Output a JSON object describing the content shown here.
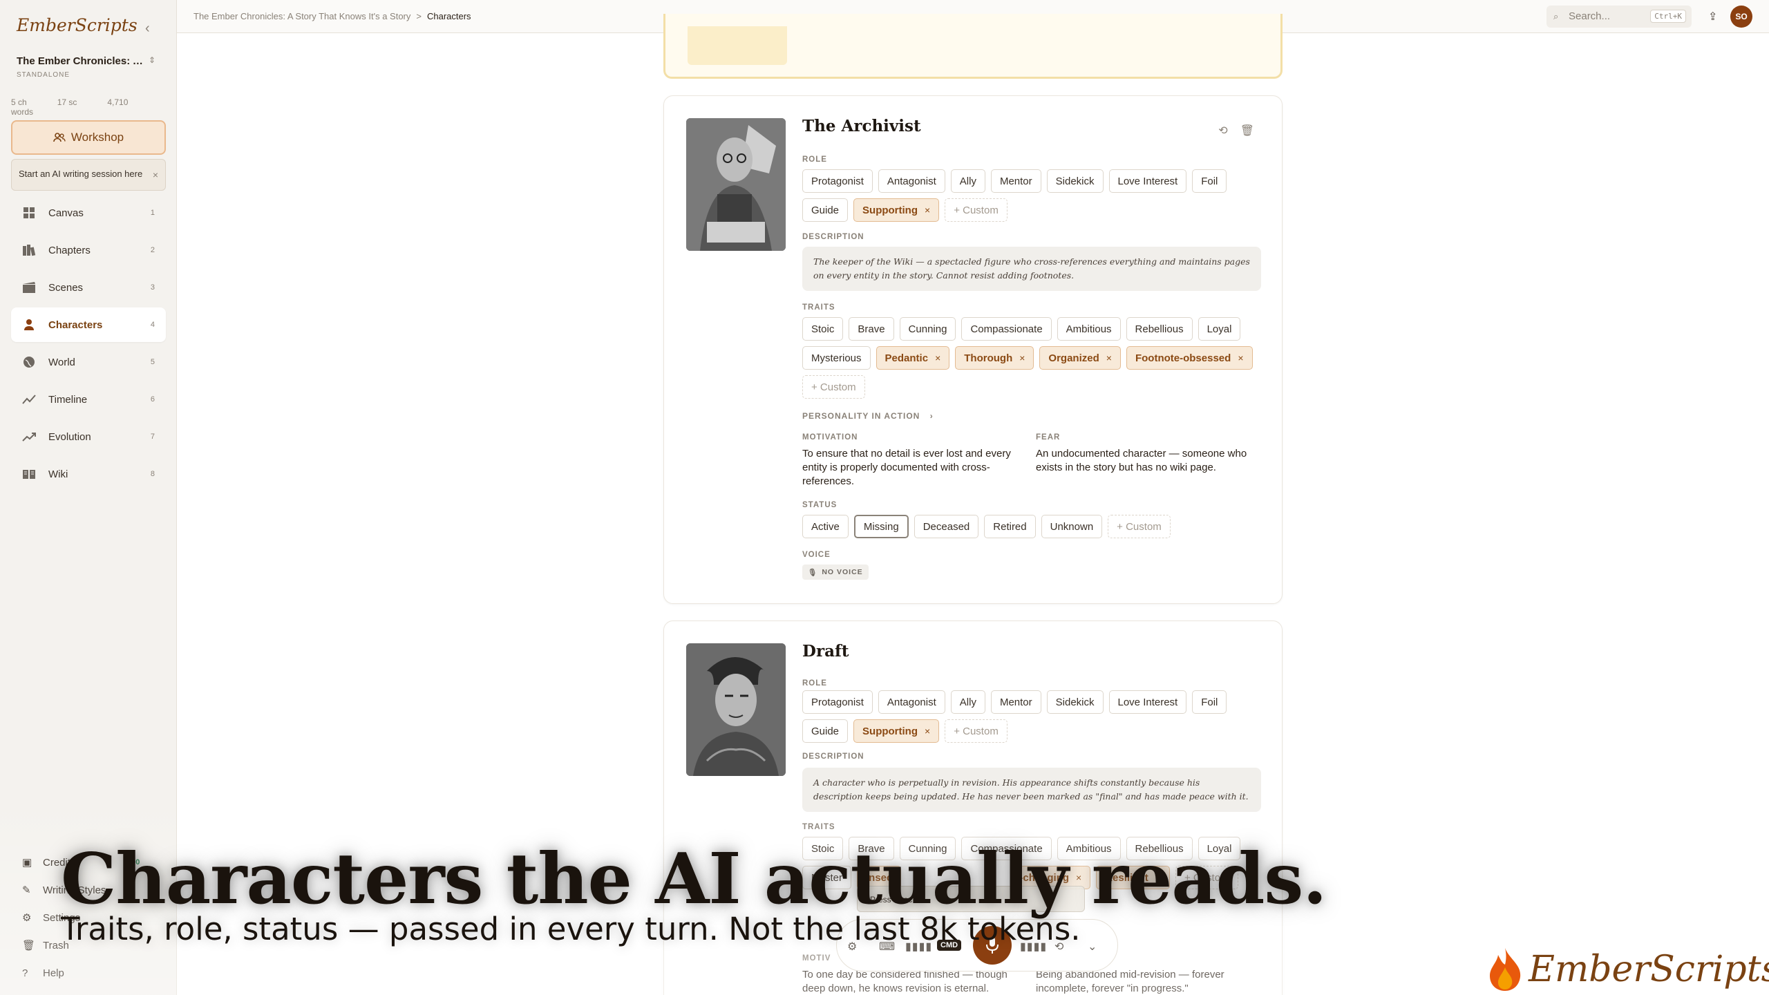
{
  "app": {
    "logo": "EmberScripts",
    "project_title": "The Ember Chronicles: A...",
    "project_subtitle": "STANDALONE",
    "stats": [
      "5 ch",
      "17 sc",
      "4,710 words"
    ],
    "workshop_label": "Workshop",
    "tip_text": "Start an AI writing session here"
  },
  "nav": [
    {
      "label": "Canvas",
      "num": "1",
      "icon": "grid-icon"
    },
    {
      "label": "Chapters",
      "num": "2",
      "icon": "book-icon"
    },
    {
      "label": "Scenes",
      "num": "3",
      "icon": "film-icon"
    },
    {
      "label": "Characters",
      "num": "4",
      "icon": "person-icon"
    },
    {
      "label": "World",
      "num": "5",
      "icon": "globe-icon"
    },
    {
      "label": "Timeline",
      "num": "6",
      "icon": "timeline-icon"
    },
    {
      "label": "Evolution",
      "num": "7",
      "icon": "trending-icon"
    },
    {
      "label": "Wiki",
      "num": "8",
      "icon": "wiki-icon"
    }
  ],
  "bottom_nav": {
    "credits": "Credits",
    "credits_badge": "500",
    "writing_styles": "Writing Styles",
    "settings": "Settings",
    "trash": "Trash",
    "help": "Help"
  },
  "topbar": {
    "crumb_project": "The Ember Chronicles: A Story That Knows It's a Story",
    "crumb_sep": ">",
    "crumb_current": "Characters",
    "search_placeholder": "Search...",
    "search_shortcut": "Ctrl+K",
    "avatar": "SO"
  },
  "labels": {
    "role": "ROLE",
    "description": "DESCRIPTION",
    "traits": "TRAITS",
    "personality": "PERSONALITY IN ACTION",
    "motivation": "MOTIVATION",
    "fear": "FEAR",
    "status": "STATUS",
    "voice": "VOICE",
    "no_voice": "NO VOICE",
    "motiv_partial": "MOTIV"
  },
  "archivist": {
    "name": "The Archivist",
    "roles": [
      "Protagonist",
      "Antagonist",
      "Ally",
      "Mentor",
      "Sidekick",
      "Love Interest",
      "Foil",
      "Guide"
    ],
    "role_selected": "Supporting",
    "custom": "+ Custom",
    "description": "The keeper of the Wiki — a spectacled figure who cross-references everything and maintains pages on every entity in the story. Cannot resist adding footnotes.",
    "traits": [
      "Stoic",
      "Brave",
      "Cunning",
      "Compassionate",
      "Ambitious",
      "Rebellious",
      "Loyal",
      "Mysterious"
    ],
    "traits_selected": [
      "Pedantic",
      "Thorough",
      "Organized",
      "Footnote-obsessed"
    ],
    "motivation": "To ensure that no detail is ever lost and every entity is properly documented with cross-references.",
    "fear": "An undocumented character — someone who exists in the story but has no wiki page.",
    "statuses": [
      "Active",
      "Missing",
      "Deceased",
      "Retired",
      "Unknown"
    ],
    "status_selected": "Missing"
  },
  "draft": {
    "name": "Draft",
    "roles": [
      "Protagonist",
      "Antagonist",
      "Ally",
      "Mentor",
      "Sidekick",
      "Love Interest",
      "Foil",
      "Guide"
    ],
    "role_selected": "Supporting",
    "custom": "+ Custom",
    "description": "A character who is perpetually in revision. His appearance shifts constantly because his description keeps being updated. He has never been marked as \"final\" and has made peace with it.",
    "traits": [
      "Stoic",
      "Brave",
      "Cunning",
      "Compassionate",
      "Ambitious",
      "Rebellious",
      "Loyal"
    ],
    "trait_partial_1": "Myster",
    "trait_partial_2": "Insec",
    "trait_partial_3": "-changing",
    "trait_resilient": "Resilient",
    "motivation": "To one day be considered finished — though deep down, he knows revision is eternal.",
    "fear": "Being abandoned mid-revision — forever incomplete, forever \"in progress.\""
  },
  "overlay": {
    "headline": "Characters the AI actually reads.",
    "subline": "Traits, role, status — passed in every turn. Not the last 8k tokens.",
    "tooltip": "Press Spac",
    "cmd": "CMD",
    "brand": "EmberScripts"
  },
  "colors": {
    "accent": "#8b3f10",
    "chip_selected_bg": "#f8ead9",
    "sidebar_bg": "#f4f2ee"
  }
}
